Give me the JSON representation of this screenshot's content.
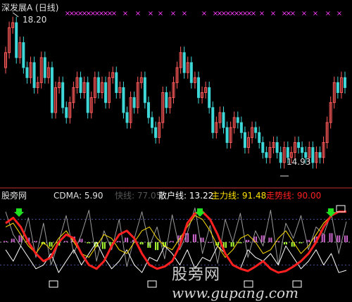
{
  "upper_panel": {
    "title": "深发展A (日线)",
    "high_label": "18.20",
    "low_label": "14.93"
  },
  "lower_panel": {
    "brand": "股旁网",
    "cdma_label": "CDMA: 5.90",
    "fast_label": "快线: 77.05",
    "retail_label": "散户线: 13.22",
    "main_label": "主力线: 91.48",
    "trend_label": "走势线: 90.00"
  },
  "watermark": {
    "cn": "股旁网",
    "url": "www.gupang.com"
  },
  "colors": {
    "up_candle": "#ff5a5a",
    "down_candle": "#3fd7d7",
    "title": "#e0e0e0",
    "cdma": "#e0e0e0",
    "fast": "#9a9a9a",
    "retail": "#ffffff",
    "main": "#ffe000",
    "trend": "#ff2020",
    "marker_x": "#ff3cff",
    "arrow": "#20e020",
    "bar_pos": "#cc66cc",
    "bar_neg": "#aaff33",
    "grid": "#5050a0"
  },
  "chart_data": [
    {
      "type": "candlestick",
      "title": "深发展A (日线)",
      "max": 18.2,
      "min": 14.93,
      "closes": [
        17.4,
        17.9,
        18.0,
        17.3,
        17.6,
        17.1,
        16.9,
        17.2,
        16.7,
        16.8,
        17.3,
        16.9,
        17.1,
        16.2,
        16.7,
        16.8,
        16.3,
        16.1,
        16.4,
        16.7,
        16.9,
        16.6,
        16.8,
        16.2,
        16.5,
        16.9,
        16.6,
        16.8,
        16.4,
        16.9,
        17.0,
        16.6,
        16.7,
        16.2,
        16.0,
        16.5,
        16.3,
        16.8,
        16.9,
        16.4,
        16.1,
        15.9,
        15.7,
        16.0,
        16.6,
        16.3,
        16.5,
        16.8,
        17.1,
        17.4,
        17.0,
        17.2,
        16.8,
        16.9,
        16.5,
        16.6,
        16.7,
        16.3,
        15.8,
        16.0,
        16.2,
        15.9,
        15.6,
        15.9,
        16.1,
        16.0,
        15.8,
        15.5,
        15.7,
        15.9,
        15.8,
        15.6,
        15.4,
        15.3,
        15.5,
        15.6,
        15.4,
        15.2,
        15.5,
        15.3,
        15.4,
        15.6,
        15.5,
        15.4,
        15.3,
        15.5,
        15.2,
        15.4,
        15.3,
        15.6,
        16.0,
        16.4,
        16.8,
        16.6,
        16.9,
        16.7
      ],
      "markers": {
        "high": 18.2,
        "low": 14.93
      }
    },
    {
      "type": "line",
      "title": "CDMA",
      "ylim": [
        0,
        100
      ],
      "series": [
        {
          "name": "快线",
          "values": [
            90,
            60,
            45,
            82,
            30,
            75,
            20,
            50,
            85,
            35,
            60,
            92,
            25,
            65,
            40,
            80,
            18,
            55,
            90,
            45,
            70,
            28,
            86,
            40,
            62,
            95,
            35,
            72,
            22,
            80,
            50,
            88,
            30,
            65,
            45,
            92,
            20,
            75,
            55,
            85,
            40,
            70,
            60,
            88,
            35,
            77
          ]
        },
        {
          "name": "散户线",
          "values": [
            40,
            25,
            45,
            30,
            15,
            20,
            35,
            10,
            25,
            40,
            20,
            35,
            50,
            30,
            15,
            25,
            40,
            20,
            10,
            30,
            25,
            45,
            35,
            20,
            40,
            15,
            30,
            25,
            45,
            35,
            20,
            15,
            40,
            30,
            25,
            35,
            20,
            45,
            30,
            15,
            25,
            40,
            20,
            35,
            10,
            13
          ]
        },
        {
          "name": "主力线",
          "values": [
            70,
            75,
            60,
            45,
            35,
            50,
            40,
            55,
            65,
            50,
            35,
            30,
            45,
            60,
            55,
            40,
            35,
            50,
            65,
            70,
            55,
            45,
            40,
            55,
            70,
            85,
            80,
            65,
            45,
            30,
            40,
            55,
            60,
            50,
            35,
            40,
            55,
            65,
            50,
            35,
            45,
            60,
            75,
            85,
            90,
            91
          ]
        },
        {
          "name": "走势线",
          "values": [
            75,
            82,
            70,
            50,
            35,
            25,
            30,
            50,
            60,
            55,
            35,
            20,
            15,
            25,
            45,
            60,
            65,
            55,
            35,
            20,
            15,
            18,
            25,
            45,
            75,
            88,
            90,
            80,
            60,
            35,
            20,
            15,
            12,
            18,
            25,
            15,
            10,
            12,
            18,
            25,
            35,
            50,
            70,
            85,
            90,
            90
          ]
        },
        {
          "name": "CDMA",
          "values": [
            1,
            3,
            6,
            4,
            1,
            -2,
            -4,
            -3,
            1,
            5,
            3,
            -1,
            -4,
            -6,
            -3,
            1,
            4,
            2,
            -2,
            -5,
            -7,
            -4,
            1,
            6,
            8,
            7,
            4,
            0,
            -3,
            -5,
            -4,
            -1,
            2,
            5,
            6,
            4,
            1,
            -2,
            -4,
            -1,
            2,
            5,
            7,
            8,
            6,
            5.9
          ]
        }
      ]
    }
  ]
}
